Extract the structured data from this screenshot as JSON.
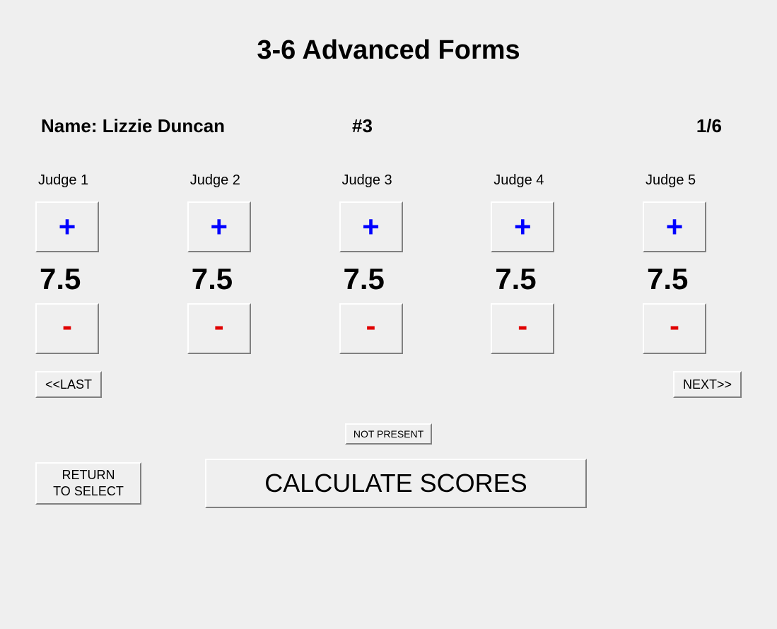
{
  "title": "3-6 Advanced Forms",
  "competitor": {
    "name_label": "Name: Lizzie Duncan",
    "number": "#3",
    "progress": "1/6"
  },
  "judges": [
    {
      "label": "Judge 1",
      "score": "7.5"
    },
    {
      "label": "Judge 2",
      "score": "7.5"
    },
    {
      "label": "Judge 3",
      "score": "7.5"
    },
    {
      "label": "Judge 4",
      "score": "7.5"
    },
    {
      "label": "Judge 5",
      "score": "7.5"
    }
  ],
  "buttons": {
    "plus": "+",
    "minus": "-",
    "last": "<<LAST",
    "next": "NEXT>>",
    "not_present": "NOT PRESENT",
    "return": "RETURN\nTO SELECT",
    "calculate": "CALCULATE SCORES"
  }
}
